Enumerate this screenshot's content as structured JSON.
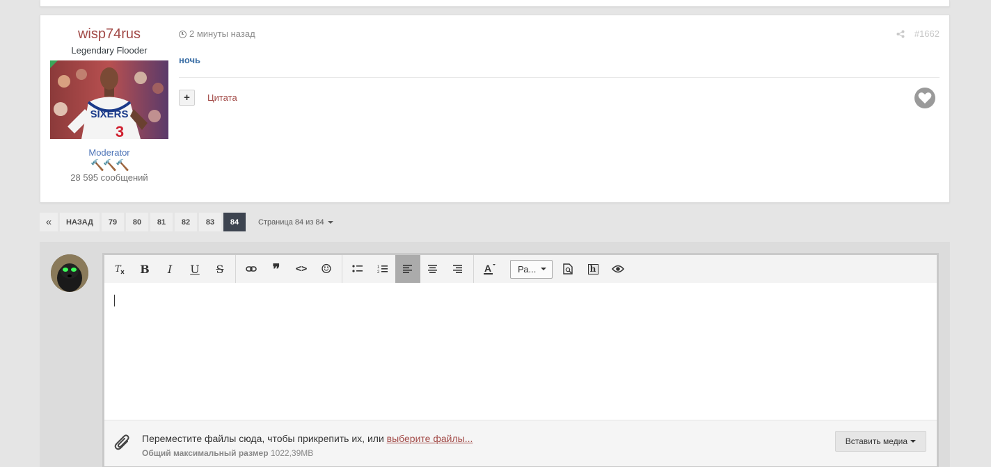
{
  "post": {
    "author": {
      "name": "wisp74rus",
      "title": "Legendary Flooder",
      "group": "Moderator",
      "rank_pips": "🔨🔨🔨",
      "posts_count": "28 595 сообщений"
    },
    "time": "2 минуты назад",
    "post_number": "#1662",
    "content": "ночь",
    "quote_label": "Цитата",
    "plus_label": "+"
  },
  "pagination": {
    "first_label": "«",
    "prev_label": "НАЗАД",
    "pages": [
      "79",
      "80",
      "81",
      "82",
      "83",
      "84"
    ],
    "active_page": "84",
    "jump_label": "Страница 84 из 84"
  },
  "editor": {
    "toolbar": {
      "icons": {
        "clear_format": "clear-format-icon",
        "bold": "bold-icon",
        "italic": "italic-icon",
        "underline": "underline-icon",
        "strike": "strikethrough-icon",
        "link": "link-icon",
        "quote": "quote-icon",
        "code": "code-icon",
        "emoji": "smiley-icon",
        "bullet_list": "bullet-list-icon",
        "numbered_list": "numbered-list-icon",
        "align_left": "align-left-icon",
        "align_center": "align-center-icon",
        "align_right": "align-right-icon",
        "text_color": "text-color-icon",
        "preview": "preview-icon",
        "source": "source-icon",
        "spoiler": "eye-icon"
      },
      "labels": {
        "bold": "B",
        "italic": "I",
        "underline": "U",
        "strike": "S",
        "quote": "❞",
        "code": "<>",
        "emoji": "☺",
        "text_color": "A",
        "source": "h"
      },
      "font_select": "Ра..."
    },
    "attach": {
      "text": "Переместите файлы сюда, чтобы прикрепить их, или ",
      "link": "выберите файлы...",
      "size_label": "Общий максимальный размер",
      "size_value": "1022,39MB",
      "insert_media": "Вставить медиа"
    }
  },
  "colors": {
    "author_name": "#a24a47",
    "group": "#4d74b7",
    "content": "#3a6ea5",
    "active_page": "#3d4450",
    "online": "#3aa65a"
  }
}
